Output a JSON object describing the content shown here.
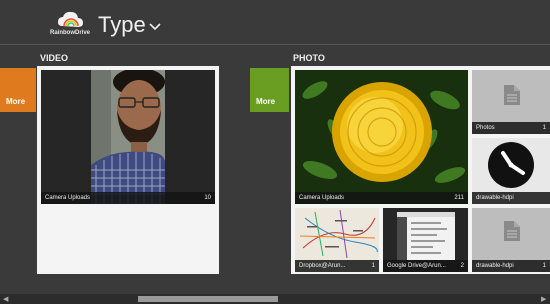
{
  "header": {
    "logo_text": "RainbowDrive",
    "title": "Type"
  },
  "sections": {
    "video": {
      "title": "VIDEO",
      "more_label": "More",
      "more_color": "#e07a1f",
      "tiles": [
        {
          "label": "Camera Uploads",
          "count": "10"
        }
      ]
    },
    "photo": {
      "title": "PHOTO",
      "more_label": "More",
      "more_color": "#6a9e22",
      "tiles": [
        {
          "label": "Camera Uploads",
          "count": "211"
        },
        {
          "label": "Photos",
          "count": "1"
        },
        {
          "label": "drawable-hdpi",
          "count": ""
        },
        {
          "label": "Dropbox@Arun...",
          "count": "1"
        },
        {
          "label": "Google Drive@Arun...",
          "count": "2"
        },
        {
          "label": "drawable-hdpi",
          "count": "1"
        }
      ]
    }
  },
  "icons": {
    "file": "document-icon",
    "clock": "clock-icon",
    "chevron": "chevron-down-icon",
    "logo": "cloud-rainbow-logo-icon"
  }
}
